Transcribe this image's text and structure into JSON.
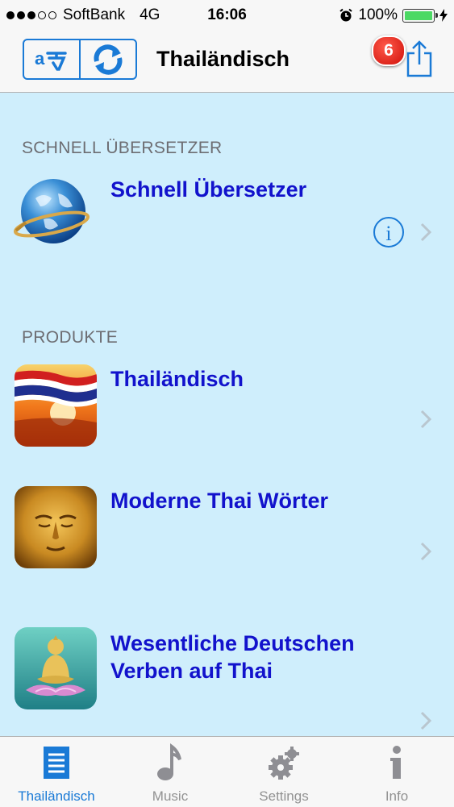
{
  "status_bar": {
    "carrier": "SoftBank",
    "network": "4G",
    "time": "16:06",
    "battery": "100%",
    "signal_bars": 3,
    "signal_total": 5
  },
  "nav": {
    "title": "Thailändisch",
    "badge": "6"
  },
  "sections": {
    "quick": {
      "header": "SCHNELL ÜBERSETZER",
      "item_title": "Schnell Übersetzer"
    },
    "products": {
      "header": "PRODUKTE",
      "items": [
        {
          "title": "Thailändisch"
        },
        {
          "title": "Moderne Thai Wörter"
        },
        {
          "title_line1": "Wesentliche Deutschen",
          "title_line2": "Verben auf Thai"
        }
      ]
    }
  },
  "tabs": [
    {
      "label": "Thailändisch",
      "icon": "list-icon",
      "active": true
    },
    {
      "label": "Music",
      "icon": "music-note-icon",
      "active": false
    },
    {
      "label": "Settings",
      "icon": "gears-icon",
      "active": false
    },
    {
      "label": "Info",
      "icon": "info-icon",
      "active": false
    }
  ],
  "colors": {
    "accent": "#1a7ad6",
    "title_text": "#1212cc",
    "background": "#cfeefc",
    "badge": "#d0100a"
  }
}
